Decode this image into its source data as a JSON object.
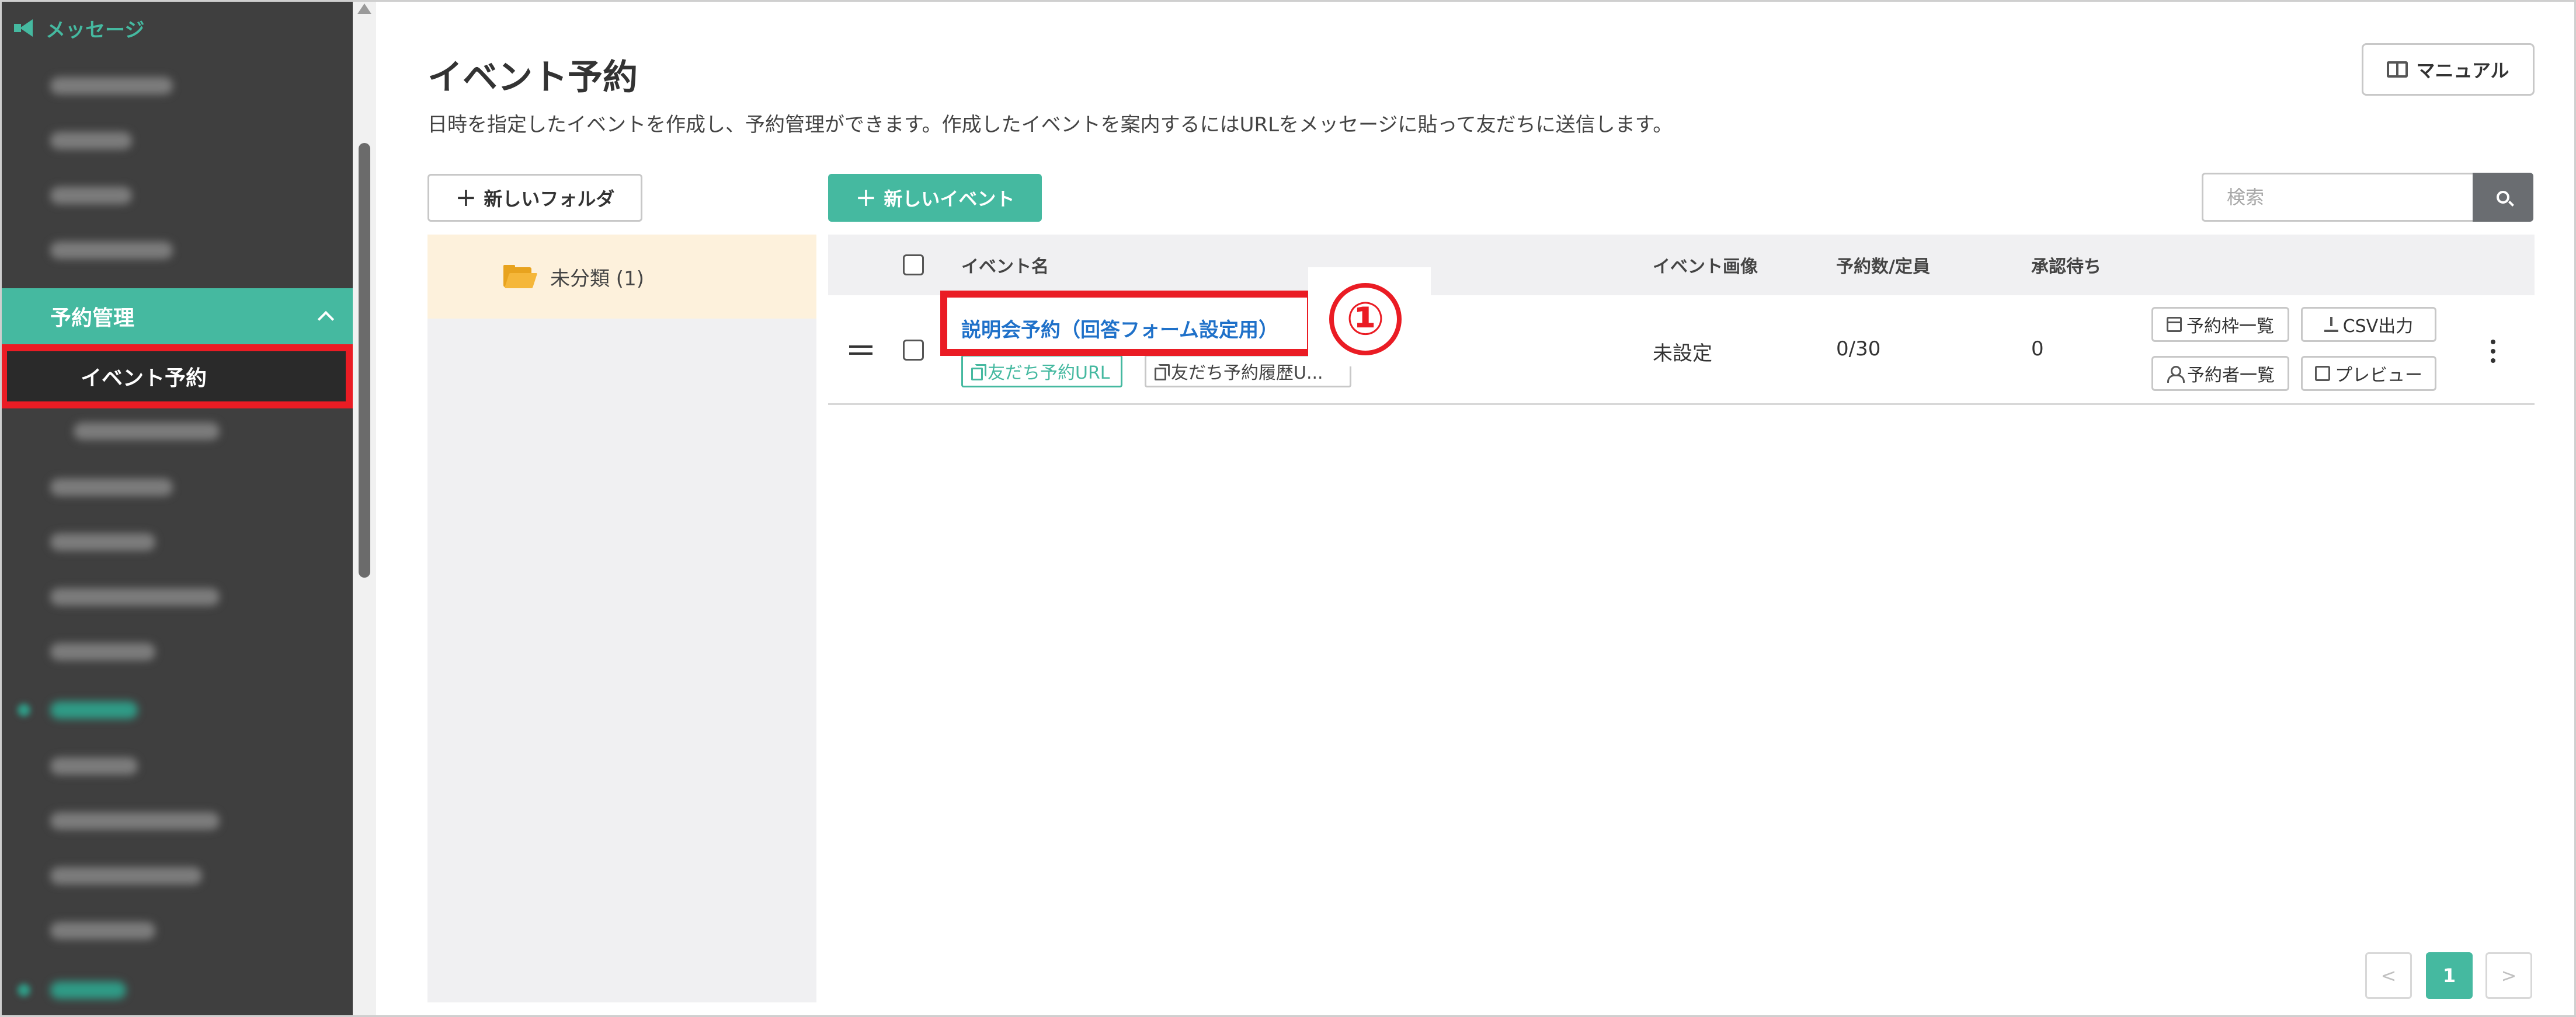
{
  "sidebar": {
    "header_label": "メッセージ",
    "active_group_label": "予約管理",
    "current_item_label": "イベント予約"
  },
  "page": {
    "title": "イベント予約",
    "description": "日時を指定したイベントを作成し、予約管理ができます。作成したイベントを案内するにはURLをメッセージに貼って友だちに送信します。",
    "manual_label": "マニュアル"
  },
  "toolbar": {
    "new_folder_label": "新しいフォルダ",
    "new_event_label": "新しいイベント",
    "search_placeholder": "検索"
  },
  "folders": [
    {
      "label": "未分類 (1)"
    }
  ],
  "table": {
    "headers": {
      "name": "イベント名",
      "image": "イベント画像",
      "reservations": "予約数/定員",
      "pending": "承認待ち"
    },
    "rows": [
      {
        "name": "説明会予約（回答フォーム設定用）",
        "friend_url_label": "友だち予約URL",
        "friend_history_label": "友だち予約履歴U...",
        "image": "未設定",
        "reservations": "0/30",
        "pending": "0",
        "actions": {
          "slots": "予約枠一覧",
          "csv": "CSV出力",
          "reservers": "予約者一覧",
          "preview": "プレビュー"
        }
      }
    ]
  },
  "annotation": {
    "marker": "①"
  },
  "pagination": {
    "prev": "<",
    "current": "1",
    "next": ">"
  },
  "colors": {
    "accent": "#45b9a0",
    "highlight": "#ea1c24",
    "link": "#1f71c9",
    "sidebar_bg": "#3f3f3f"
  }
}
